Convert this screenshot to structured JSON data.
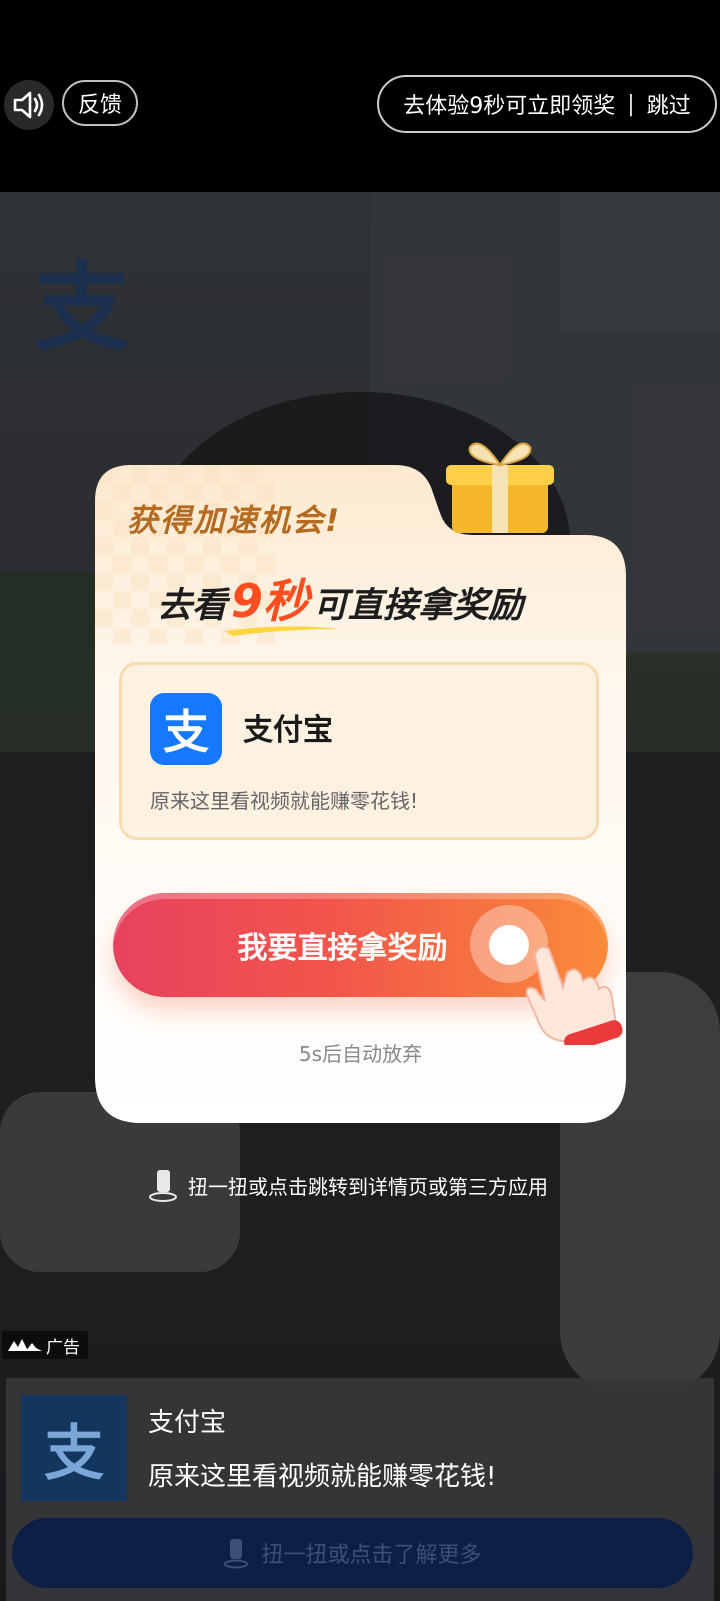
{
  "top": {
    "feedback_label": "反馈",
    "skip_prompt": "去体验9秒可立即领奖",
    "skip_separator": "|",
    "skip_label": "跳过"
  },
  "video": {
    "watermark_logo": "支"
  },
  "modal": {
    "title": "获得加速机会!",
    "headline_prefix": "去看",
    "headline_highlight": "9秒",
    "headline_suffix": "可直接拿奖励",
    "app_icon_glyph": "支",
    "app_name": "支付宝",
    "app_desc": "原来这里看视频就能赚零花钱!",
    "cta_label": "我要直接拿奖励",
    "countdown": "5s后自动放弃"
  },
  "hint": {
    "text": "扭一扭或点击跳转到详情页或第三方应用"
  },
  "ad_tag": {
    "label": "广告"
  },
  "bottom_card": {
    "logo_glyph": "支",
    "name": "支付宝",
    "desc": "原来这里看视频就能赚零花钱!",
    "button_label": "扭一扭或点击了解更多"
  },
  "colors": {
    "cta_start": "#e8415f",
    "cta_end": "#fa8a3a",
    "highlight": "#ff4d1f",
    "title_gold": "#b46a1f",
    "alipay_blue": "#1677ff"
  }
}
